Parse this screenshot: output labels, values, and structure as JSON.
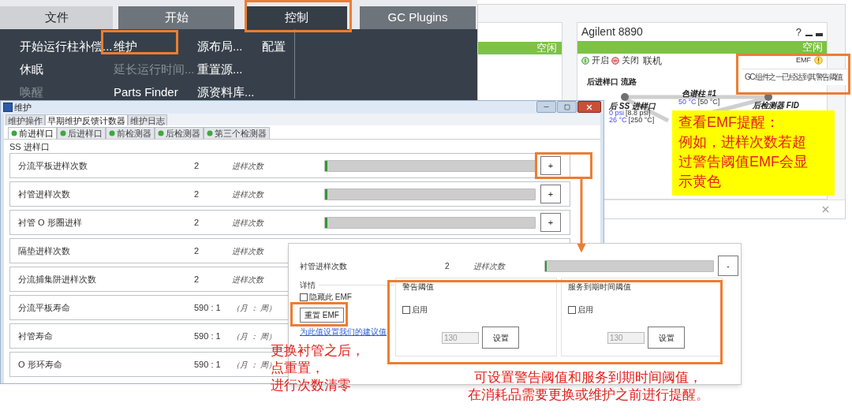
{
  "top_menu": {
    "tabs": [
      {
        "label": "文件",
        "selected": false
      },
      {
        "label": "开始",
        "selected": false
      },
      {
        "label": "控制",
        "selected": true
      },
      {
        "label": "GC Plugins",
        "selected": false
      }
    ],
    "columns": [
      [
        {
          "label": "开始运行柱补偿...",
          "disabled": false
        },
        {
          "label": "休眠",
          "disabled": false
        },
        {
          "label": "唤醒",
          "disabled": true
        }
      ],
      [
        {
          "label": "维护",
          "disabled": false
        },
        {
          "label": "延长运行时间...",
          "disabled": true
        },
        {
          "label": "Parts Finder",
          "disabled": false
        }
      ],
      [
        {
          "label": "源布局...",
          "disabled": false
        },
        {
          "label": "重置源...",
          "disabled": false
        },
        {
          "label": "源资料库...",
          "disabled": false
        }
      ],
      [
        {
          "label": "配置",
          "disabled": false
        }
      ]
    ]
  },
  "gc_panel": {
    "left_status": "空闲",
    "title": "Agilent 8890",
    "help": "?",
    "status": "空闲",
    "on_label": "开启",
    "off_label": "关闭",
    "mode": "联机",
    "emf_label": "EMF",
    "emf_warning": true,
    "emf_message": "GC 组件之一已经达到其警告阈值",
    "flow_title": "后进样口 流路",
    "nodes": [
      {
        "kind": "inlet",
        "name": "后 SS 进样口",
        "pressure": "0 psi",
        "pressure_setpoint": "[8.8 psi]",
        "temp": "26 °C",
        "temp_setpoint": "[250 °C]"
      },
      {
        "kind": "column",
        "name": "色谱柱 #1",
        "temp": "50 °C",
        "temp_setpoint": "[50 °C]"
      },
      {
        "kind": "detector",
        "name": "后检测器 FID"
      }
    ]
  },
  "maintenance_window": {
    "title": "维护",
    "tabs": [
      {
        "label": "维护操作",
        "selected": false
      },
      {
        "label": "早期维护反馈计数器",
        "selected": true
      },
      {
        "label": "维护日志",
        "selected": false
      }
    ],
    "sub_tabs": [
      {
        "label": "前进样口",
        "selected": true
      },
      {
        "label": "后进样口",
        "selected": false
      },
      {
        "label": "前检测器",
        "selected": false
      },
      {
        "label": "后检测器",
        "selected": false
      },
      {
        "label": "第三个检测器",
        "selected": false
      }
    ],
    "group_title": "SS 进样口",
    "rows": [
      {
        "label": "分流平板进样次数",
        "value": "2",
        "unit": "进样次数",
        "level": 0.01,
        "button": "+"
      },
      {
        "label": "衬管进样次数",
        "value": "2",
        "unit": "进样次数",
        "level": 0.01,
        "button": "+"
      },
      {
        "label": "衬管 O 形圈进样",
        "value": "2",
        "unit": "进样次数",
        "level": 0.01,
        "button": "+"
      },
      {
        "label": "隔垫进样次数",
        "value": "2",
        "unit": "进样次数"
      },
      {
        "label": "分流捕集阱进样次数",
        "value": "2",
        "unit": "进样次数"
      },
      {
        "label": "分流平板寿命",
        "value": "590 : 1",
        "unit": "（月 ： 周）"
      },
      {
        "label": "衬管寿命",
        "value": "590 : 1",
        "unit": "（月 ： 周）"
      },
      {
        "label": "O 形环寿命",
        "value": "590 : 1",
        "unit": "（月 ： 周）"
      }
    ]
  },
  "detail_panel": {
    "label": "衬管进样次数",
    "value": "2",
    "unit": "进样次数",
    "level": 0.01,
    "button": "-",
    "details_title": "详情",
    "hide_emf": {
      "label": "隐藏此 EMF",
      "checked": false
    },
    "reset_button": "重置 EMF",
    "default_link": "为此值设置我们的建议值",
    "thresholds": [
      {
        "title": "警告阈值",
        "enable_label": "启用",
        "enabled": false,
        "value": "130",
        "button": "设置"
      },
      {
        "title": "服务到期时间阈值",
        "enable_label": "启用",
        "enabled": false,
        "value": "130",
        "button": "设置"
      }
    ]
  },
  "annotations": {
    "emf_note": [
      "查看EMF提醒：",
      "例如，进样次数若超",
      "过警告阈值EMF会显",
      "示黄色"
    ],
    "reset_note": [
      "更换衬管之后，",
      "点重置，",
      "进行次数清零"
    ],
    "threshold_note": [
      "可设置警告阈值和服务到期时间阈值，",
      "在消耗品需要更换或维护之前进行提醒。"
    ]
  }
}
